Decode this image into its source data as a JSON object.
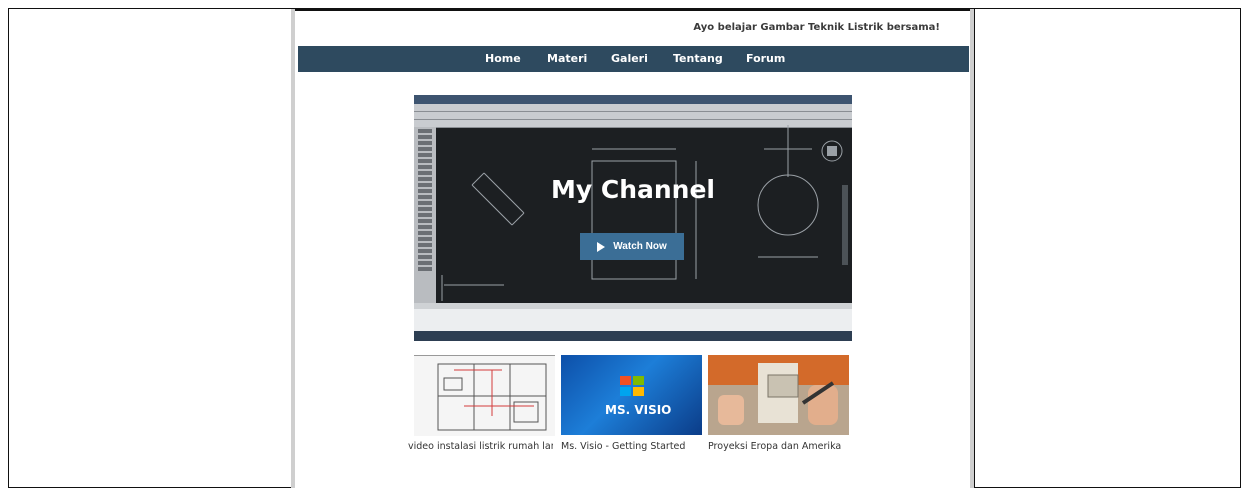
{
  "header": {
    "tagline": "Ayo belajar Gambar Teknik Listrik bersama!"
  },
  "nav": {
    "items": [
      "Home",
      "Materi",
      "Galeri",
      "Tentang",
      "Forum"
    ]
  },
  "hero": {
    "title": "My Channel",
    "button_label": "Watch Now"
  },
  "thumbnails": [
    {
      "caption": "video instalasi listrik rumah lant..."
    },
    {
      "caption": "Ms. Visio - Getting Started",
      "overlay": "MS. VISIO"
    },
    {
      "caption": "Proyeksi Eropa dan Amerika"
    }
  ],
  "colors": {
    "navbar": "#2e4a5f",
    "button": "#3b6e96",
    "hero_bg": "#1c1f22"
  }
}
